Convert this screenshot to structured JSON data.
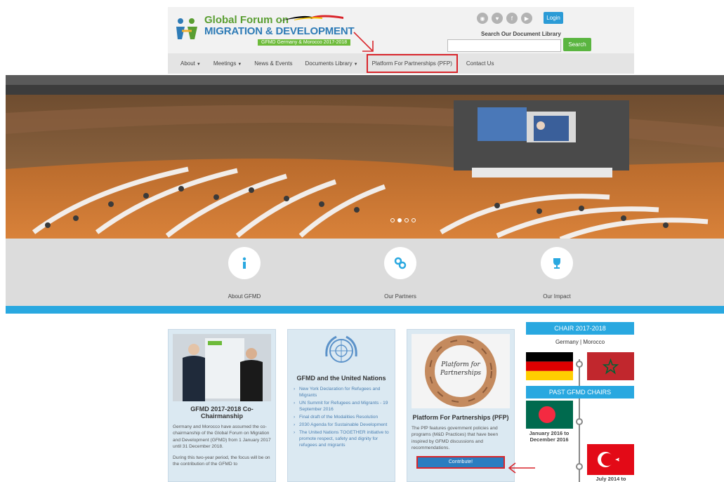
{
  "header": {
    "logo_line1": "Global Forum on",
    "logo_line2": "MIGRATION & DEVELOPMENT",
    "logo_sub": "GFMD Germany & Morocco 2017-2018",
    "login_label": "Login",
    "search_label": "Search Our Document Library",
    "search_value": "",
    "search_button": "Search"
  },
  "nav": {
    "items": [
      {
        "label": "About",
        "dropdown": true
      },
      {
        "label": "Meetings",
        "dropdown": true
      },
      {
        "label": "News & Events",
        "dropdown": false
      },
      {
        "label": "Documents Library",
        "dropdown": true
      },
      {
        "label": "Platform For Partnerships (PFP)",
        "dropdown": false,
        "highlighted": true
      },
      {
        "label": "Contact Us",
        "dropdown": false
      }
    ]
  },
  "features": [
    {
      "label": "About GFMD",
      "icon": "info-icon"
    },
    {
      "label": "Our Partners",
      "icon": "link-icon"
    },
    {
      "label": "Our Impact",
      "icon": "trophy-icon"
    }
  ],
  "cards": {
    "chair": {
      "title": "GFMD 2017-2018 Co-Chairmanship",
      "p1": "Germany and Morocco have assumed the co-chairmanship of the Global Forum on Migration and Development (GFMD) from 1 January 2017 until 31 December 2018.",
      "p2": "During this two-year period, the focus will be on the contribution of the GFMD to"
    },
    "un": {
      "title": "GFMD and the United Nations",
      "links": [
        "New York Declaration for Refugees and Migrants",
        "UN Summit for Refugees and Migrants - 19 September 2016",
        "Final draft of the Modalities Resolution",
        "2030 Agenda for Sustainable Development",
        "The United Nations TOGETHER initiative to promote respect, safety and dignity for refugees and migrants"
      ]
    },
    "pfp": {
      "image_text": "Platform for Partnerships",
      "title": "Platform For Partnerships (PFP)",
      "text": "The PfP features government policies and programs (M&D Practices) that have been inspired by GFMD discussions and recommendations.",
      "button": "Contribute!"
    }
  },
  "chair_column": {
    "current_title": "CHAIR 2017-2018",
    "current_names": "Germany | Morocco",
    "past_title": "PAST GFMD CHAIRS",
    "past": [
      {
        "caption": "January 2016 to December 2016"
      },
      {
        "caption": "July 2014 to"
      }
    ]
  },
  "colors": {
    "accent_blue": "#29a8e0",
    "highlight_red": "#d9252b",
    "green": "#5ab540"
  }
}
